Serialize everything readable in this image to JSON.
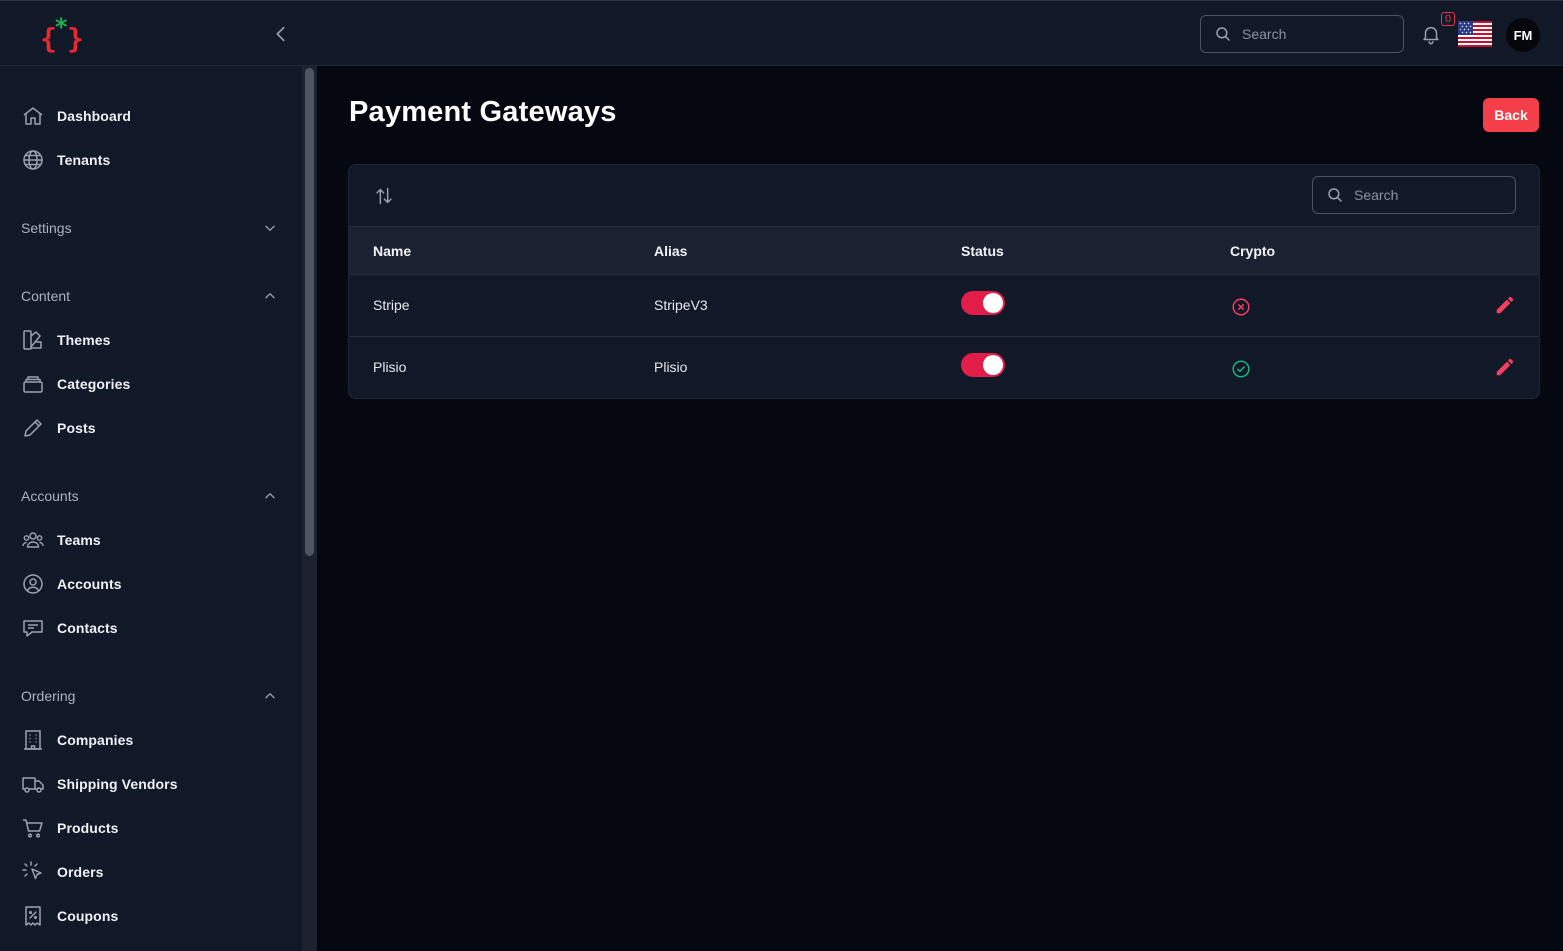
{
  "topbar": {
    "search_placeholder": "Search",
    "notification_count": "0",
    "avatar_initials": "FM"
  },
  "sidebar": {
    "top_items": [
      {
        "label": "Dashboard",
        "icon": "home-icon"
      },
      {
        "label": "Tenants",
        "icon": "globe-icon"
      }
    ],
    "groups": [
      {
        "label": "Settings",
        "expanded": false,
        "items": []
      },
      {
        "label": "Content",
        "expanded": true,
        "items": [
          {
            "label": "Themes",
            "icon": "swatch-icon"
          },
          {
            "label": "Categories",
            "icon": "stack-icon"
          },
          {
            "label": "Posts",
            "icon": "pencil-icon"
          }
        ]
      },
      {
        "label": "Accounts",
        "expanded": true,
        "items": [
          {
            "label": "Teams",
            "icon": "users-group-icon"
          },
          {
            "label": "Accounts",
            "icon": "user-circle-icon"
          },
          {
            "label": "Contacts",
            "icon": "chat-icon"
          }
        ]
      },
      {
        "label": "Ordering",
        "expanded": true,
        "items": [
          {
            "label": "Companies",
            "icon": "building-icon"
          },
          {
            "label": "Shipping Vendors",
            "icon": "truck-icon"
          },
          {
            "label": "Products",
            "icon": "cart-icon"
          },
          {
            "label": "Orders",
            "icon": "cursor-click-icon"
          },
          {
            "label": "Coupons",
            "icon": "receipt-percent-icon"
          }
        ]
      }
    ]
  },
  "main": {
    "title": "Payment Gateways",
    "back_label": "Back",
    "table": {
      "search_placeholder": "Search",
      "columns": [
        "Name",
        "Alias",
        "Status",
        "Crypto"
      ],
      "rows": [
        {
          "name": "Stripe",
          "alias": "StripeV3",
          "status": true,
          "crypto": false
        },
        {
          "name": "Plisio",
          "alias": "Plisio",
          "status": true,
          "crypto": true
        }
      ]
    }
  },
  "colors": {
    "accent": "#f43f4a",
    "toggle_on": "#e11d48",
    "crypto_no": "#f43f5e",
    "crypto_yes": "#10b981",
    "edit": "#f43f5e"
  }
}
